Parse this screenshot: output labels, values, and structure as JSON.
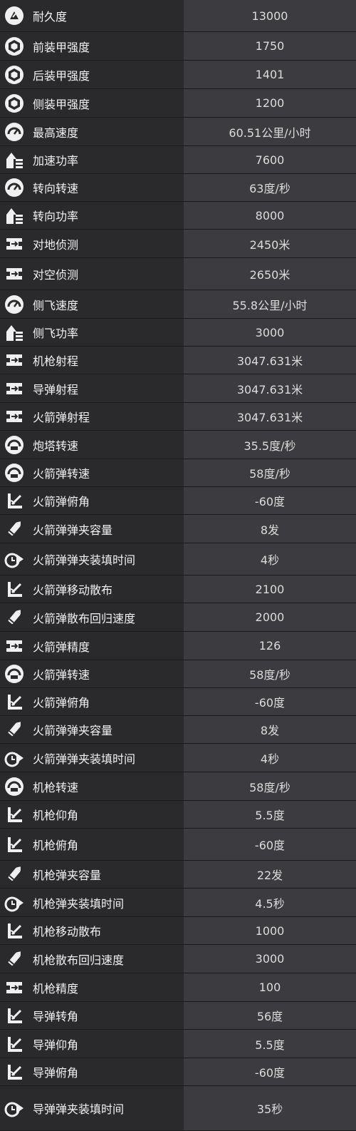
{
  "stats": [
    {
      "icon": "durability-icon",
      "label": "耐久度",
      "value": "13000"
    },
    {
      "icon": "armor-icon",
      "label": "前装甲强度",
      "value": "1750"
    },
    {
      "icon": "armor-icon",
      "label": "后装甲强度",
      "value": "1401"
    },
    {
      "icon": "armor-icon",
      "label": "侧装甲强度",
      "value": "1200"
    },
    {
      "icon": "speedometer-icon",
      "label": "最高速度",
      "value": "60.51公里/小时"
    },
    {
      "icon": "power-icon",
      "label": "加速功率",
      "value": "7600"
    },
    {
      "icon": "speedometer-icon",
      "label": "转向转速",
      "value": "63度/秒"
    },
    {
      "icon": "power-icon",
      "label": "转向功率",
      "value": "8000"
    },
    {
      "icon": "range-icon",
      "label": "对地侦测",
      "value": "2450米"
    },
    {
      "icon": "range-icon",
      "label": "对空侦测",
      "value": "2650米"
    },
    {
      "icon": "speedometer-icon",
      "label": "侧飞速度",
      "value": "55.8公里/小时"
    },
    {
      "icon": "power-icon",
      "label": "侧飞功率",
      "value": "3000"
    },
    {
      "icon": "range-icon",
      "label": "机枪射程",
      "value": "3047.631米"
    },
    {
      "icon": "range-icon",
      "label": "导弹射程",
      "value": "3047.631米"
    },
    {
      "icon": "range-icon",
      "label": "火箭弹射程",
      "value": "3047.631米"
    },
    {
      "icon": "turret-icon",
      "label": "炮塔转速",
      "value": "35.5度/秒"
    },
    {
      "icon": "turret-icon",
      "label": "火箭弹转速",
      "value": "58度/秒"
    },
    {
      "icon": "angle-icon",
      "label": "火箭弹俯角",
      "value": "-60度"
    },
    {
      "icon": "ammo-icon",
      "label": "火箭弹弹夹容量",
      "value": "8发"
    },
    {
      "icon": "reload-icon",
      "label": "火箭弹弹夹装填时间",
      "value": "4秒"
    },
    {
      "icon": "angle-icon",
      "label": "火箭弹移动散布",
      "value": "2100"
    },
    {
      "icon": "ammo-icon",
      "label": "火箭弹散布回归速度",
      "value": "2000"
    },
    {
      "icon": "range-icon",
      "label": "火箭弹精度",
      "value": "126"
    },
    {
      "icon": "turret-icon",
      "label": "火箭弹转速",
      "value": "58度/秒"
    },
    {
      "icon": "angle-icon",
      "label": "火箭弹俯角",
      "value": "-60度"
    },
    {
      "icon": "ammo-icon",
      "label": "火箭弹弹夹容量",
      "value": "8发"
    },
    {
      "icon": "reload-icon",
      "label": "火箭弹弹夹装填时间",
      "value": "4秒"
    },
    {
      "icon": "turret-icon",
      "label": "机枪转速",
      "value": "58度/秒"
    },
    {
      "icon": "angle-icon",
      "label": "机枪仰角",
      "value": "5.5度"
    },
    {
      "icon": "angle-icon",
      "label": "机枪俯角",
      "value": "-60度"
    },
    {
      "icon": "ammo-icon",
      "label": "机枪弹夹容量",
      "value": "22发"
    },
    {
      "icon": "reload-icon",
      "label": "机枪弹夹装填时间",
      "value": "4.5秒"
    },
    {
      "icon": "angle-icon",
      "label": "机枪移动散布",
      "value": "1000"
    },
    {
      "icon": "ammo-icon",
      "label": "机枪散布回归速度",
      "value": "3000"
    },
    {
      "icon": "range-icon",
      "label": "机枪精度",
      "value": "100"
    },
    {
      "icon": "angle-icon",
      "label": "导弹转角",
      "value": "56度"
    },
    {
      "icon": "angle-icon",
      "label": "导弹仰角",
      "value": "5.5度"
    },
    {
      "icon": "angle-icon",
      "label": "导弹俯角",
      "value": "-60度"
    },
    {
      "icon": "reload-icon",
      "label": "导弹弹夹装填时间",
      "value": "35秒"
    }
  ]
}
